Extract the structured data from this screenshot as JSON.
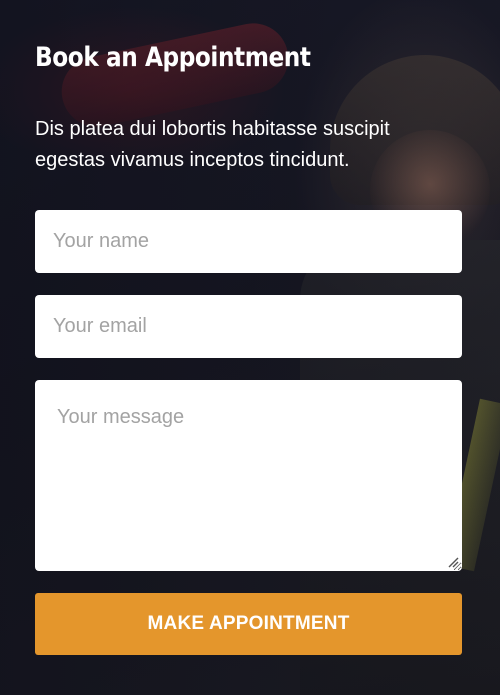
{
  "form": {
    "title": "Book an Appointment",
    "subtitle": "Dis platea dui lobortis habitasse suscipit egestas vivamus inceptos tincidunt.",
    "name_field": {
      "placeholder": "Your name",
      "value": ""
    },
    "email_field": {
      "placeholder": "Your email",
      "value": ""
    },
    "message_field": {
      "placeholder": "Your message",
      "value": ""
    },
    "submit_label": "MAKE APPOINTMENT"
  },
  "colors": {
    "accent": "#e4962c",
    "text": "#ffffff",
    "field_bg": "#ffffff",
    "placeholder": "#a3a3a3"
  },
  "background": {
    "image_subject": "firefighter-in-helmet"
  }
}
